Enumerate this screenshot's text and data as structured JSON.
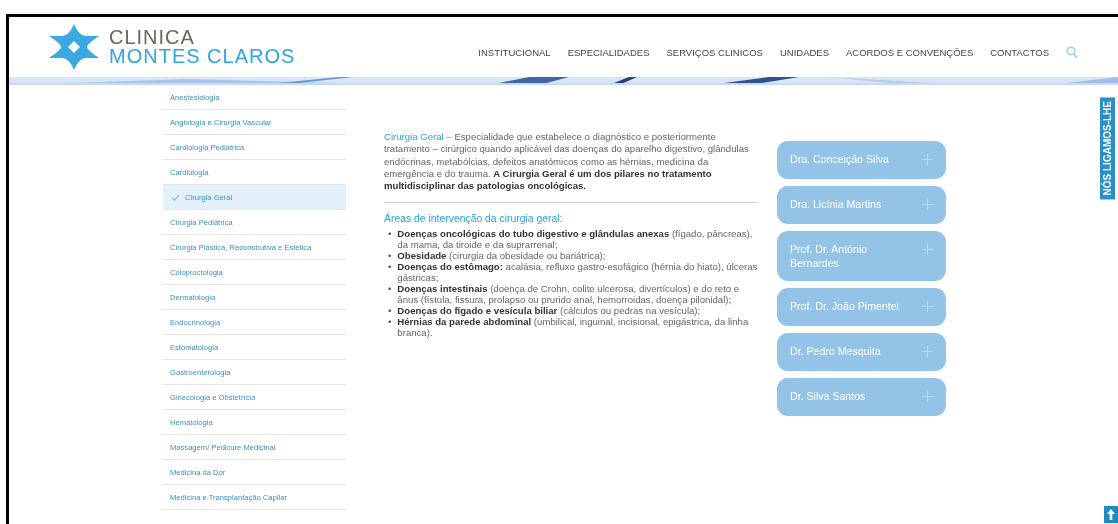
{
  "header": {
    "logo": {
      "line1": "CLINICA",
      "line2": "MONTES CLAROS"
    },
    "nav": [
      {
        "label": "INSTITUCIONAL"
      },
      {
        "label": "ESPECIALIDADES"
      },
      {
        "label": "SERVIÇOS CLINICOS"
      },
      {
        "label": "UNIDADES"
      },
      {
        "label": "ACORDOS E CONVENÇÕES"
      },
      {
        "label": "CONTACTOS"
      }
    ]
  },
  "sidebar": {
    "items": [
      {
        "label": "Anestesiologia",
        "selected": false
      },
      {
        "label": "Angiologia e Cirurgia Vascular",
        "selected": false
      },
      {
        "label": "Cardiologia Pediátrica",
        "selected": false
      },
      {
        "label": "Cardiologia",
        "selected": false
      },
      {
        "label": "Cirurgia Geral",
        "selected": true
      },
      {
        "label": "Cirurgia Pediátrica",
        "selected": false
      },
      {
        "label": "Cirurgia Plástica, Reconstrutiva e Estética",
        "selected": false
      },
      {
        "label": "Coloproctologia",
        "selected": false
      },
      {
        "label": "Dermatologia",
        "selected": false
      },
      {
        "label": "Endocrinologia",
        "selected": false
      },
      {
        "label": "Estomatologia",
        "selected": false
      },
      {
        "label": "Gastroenterologia",
        "selected": false
      },
      {
        "label": "Ginecologia e Obstetrícia",
        "selected": false
      },
      {
        "label": "Hematologia",
        "selected": false
      },
      {
        "label": "Massagem/ Pedicure Medicinal",
        "selected": false
      },
      {
        "label": "Medicina da Dor",
        "selected": false
      },
      {
        "label": "Medicina e Transplantação Capilar",
        "selected": false
      }
    ]
  },
  "article": {
    "lead": "Cirurgia Geral –",
    "intro": "Especialidade que estabelece o diagnóstico e posteriormente tratamento – cirúrgico quando aplicável das doenças do aparelho digestivo, glândulas endócrinas, metabólcias, defeitos anatómicos como as hérnias, medicina da emergência e do trauma. **A Cirurgia Geral é um dos pilares no tratamento multidisciplinar das patologias oncológicas.**",
    "heading": "Áreas de intervenção da cirurgia geral:",
    "bullets": [
      {
        "marker": "•",
        "text": "**Doenças oncológicas do tubo digestivo e glândulas anexas** (fígado, pâncreas), da mama, da tiroide e da suprarrenal;"
      },
      {
        "marker": "•",
        "text": "**Obesidade** (cirurgia da obesidade ou bariátrica);"
      },
      {
        "marker": "•",
        "text": "**Doenças do estômago:** acalásia, refluxo gastro-esofágico (hérnia do hiato), úlceras gástricas;"
      },
      {
        "marker": "•",
        "text": "**Doenças intestinais** (doença de Crohn, colite ulcerosa, divertículos) e do reto e ânus (fístula, fissura, prolapso ou prurido anal, hemorroidas, doença pilonidal);"
      },
      {
        "marker": "•",
        "text": "**Doenças do fígado e vesícula biliar** (cálculos ou pedras na vesícula);"
      },
      {
        "marker": "•",
        "text": "**Hérnias da parede abdominal** (umbilical, inguinal, incisional, epigástrica, da linha branca)."
      }
    ]
  },
  "doctors": [
    {
      "name": "Dra. Conceição Silva"
    },
    {
      "name": "Dra. Licínia Martins"
    },
    {
      "name": "Prof. Dr. António Bernardes"
    },
    {
      "name": "Prof. Dr. João Pimentel"
    },
    {
      "name": "Dr. Pedro Mesquita"
    },
    {
      "name": "Dr. Silva Santos"
    }
  ],
  "callback_tab": {
    "label": "NÓS LIGAMOS-LHE"
  }
}
